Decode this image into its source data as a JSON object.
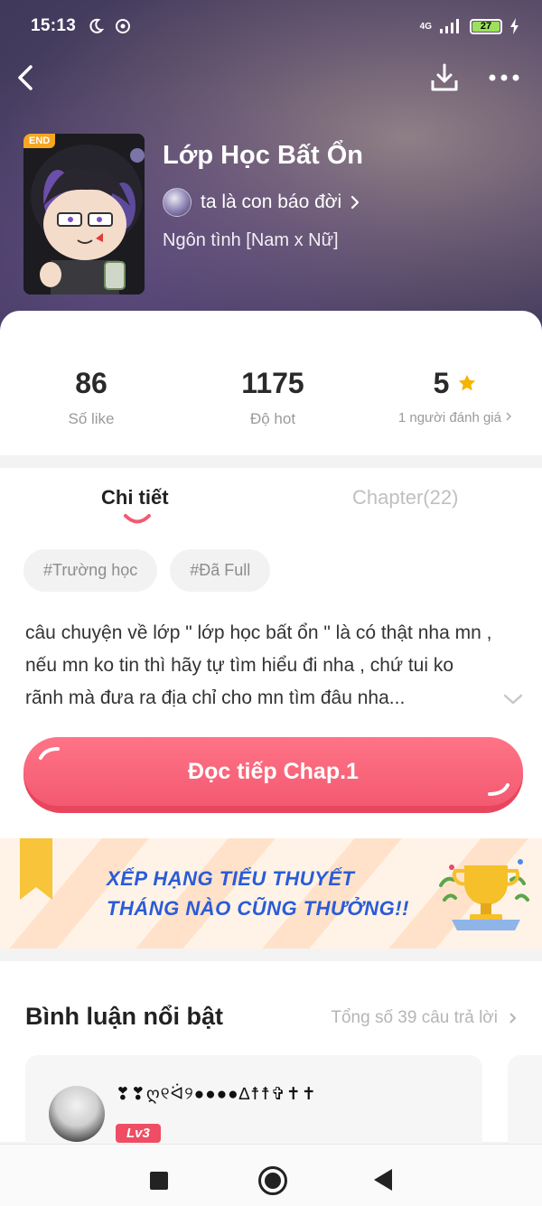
{
  "status_bar": {
    "time": "15:13",
    "network": "4G",
    "battery": "27"
  },
  "book": {
    "end_badge": "END",
    "title": "Lớp Học Bất Ổn",
    "author": "ta là con báo đời",
    "genre": "Ngôn tình [Nam x Nữ]"
  },
  "stats": {
    "likes": {
      "value": "86",
      "label": "Số like"
    },
    "hot": {
      "value": "1175",
      "label": "Độ hot"
    },
    "rating": {
      "value": "5",
      "label": "1 người đánh giá"
    }
  },
  "tabs": {
    "detail": "Chi tiết",
    "chapters": "Chapter(22)"
  },
  "tags": [
    "#Trường học",
    "#Đã Full"
  ],
  "description": "câu chuyện về lớp \" lớp học bất ổn \" là có thật nha mn , nếu mn ko tin thì hãy tự tìm hiểu đi nha , chứ tui ko rãnh mà đưa ra địa chỉ cho mn tìm đâu nha...",
  "cta_label": "Đọc tiếp Chap.1",
  "banner": {
    "line1": "XẾP HẠNG TIỂU THUYẾT",
    "line2": "THÁNG NÀO CŨNG THƯỞNG!!"
  },
  "comments": {
    "title": "Bình luận nổi bật",
    "total": "Tổng số 39 câu trả lời",
    "first": {
      "name": "❣❣ღ୧ᐛ୨●●●●∆☨☨✞✝✝",
      "level": "Lv3"
    }
  },
  "colors": {
    "accent": "#f35a71",
    "star": "#f6b300",
    "banner_text": "#2b5bd7"
  }
}
